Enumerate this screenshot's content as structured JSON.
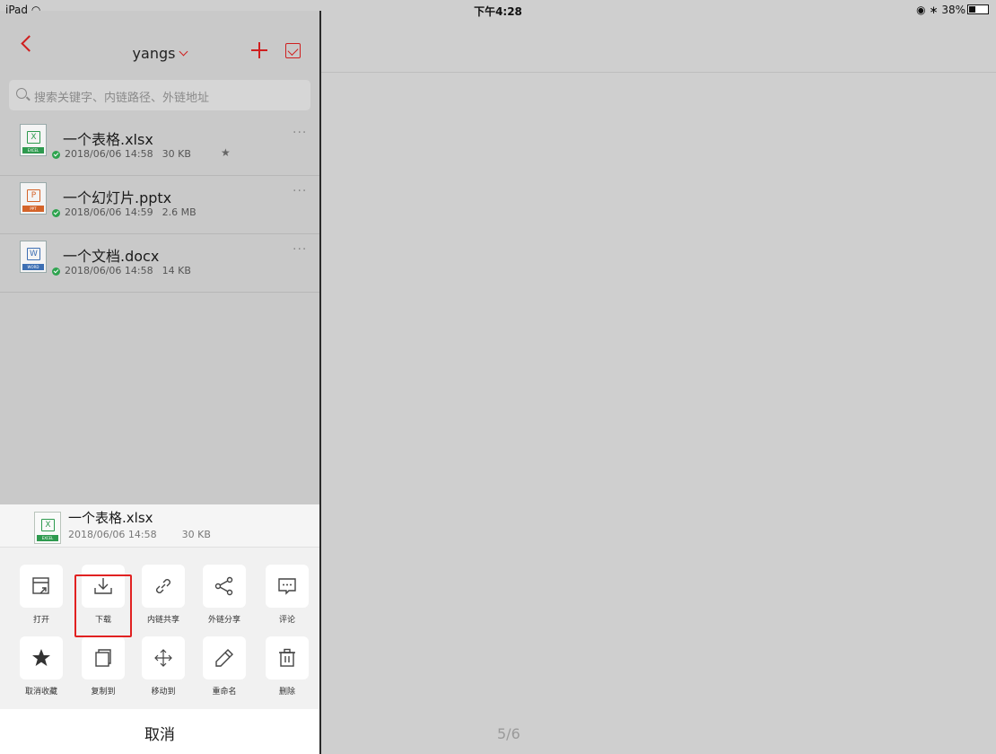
{
  "status_bar": {
    "device": "iPad",
    "time": "下午4:28",
    "battery": "38%"
  },
  "nav": {
    "title": "yangs"
  },
  "search": {
    "placeholder": "搜索关键字、内链路径、外链地址"
  },
  "files": [
    {
      "name": "一个表格.xlsx",
      "date": "2018/06/06 14:58",
      "size": "30 KB",
      "type": "EXCEL",
      "letter": "X",
      "color": "#2e9a4f",
      "starred": true
    },
    {
      "name": "一个幻灯片.pptx",
      "date": "2018/06/06 14:59",
      "size": "2.6 MB",
      "type": "PPT",
      "letter": "P",
      "color": "#d4642a",
      "starred": false
    },
    {
      "name": "一个文档.docx",
      "date": "2018/06/06 14:58",
      "size": "14 KB",
      "type": "WORD",
      "letter": "W",
      "color": "#3d6fb3",
      "starred": false
    }
  ],
  "sheet": {
    "file_name": "一个表格.xlsx",
    "file_date": "2018/06/06 14:58",
    "file_size": "30 KB",
    "file_type": "EXCEL",
    "file_letter": "X",
    "actions": [
      {
        "label": "打开",
        "icon": "open-icon"
      },
      {
        "label": "下载",
        "icon": "download-icon"
      },
      {
        "label": "内链共享",
        "icon": "link-icon"
      },
      {
        "label": "外链分享",
        "icon": "share-icon"
      },
      {
        "label": "评论",
        "icon": "comment-icon"
      },
      {
        "label": "取消收藏",
        "icon": "star-icon"
      },
      {
        "label": "复制到",
        "icon": "copy-icon"
      },
      {
        "label": "移动到",
        "icon": "move-icon"
      },
      {
        "label": "重命名",
        "icon": "pencil-icon"
      },
      {
        "label": "删除",
        "icon": "trash-icon"
      }
    ],
    "cancel": "取消"
  },
  "page_indicator": "5/6",
  "colors": {
    "accent": "#cf1f1f",
    "highlight": "#e12121"
  }
}
